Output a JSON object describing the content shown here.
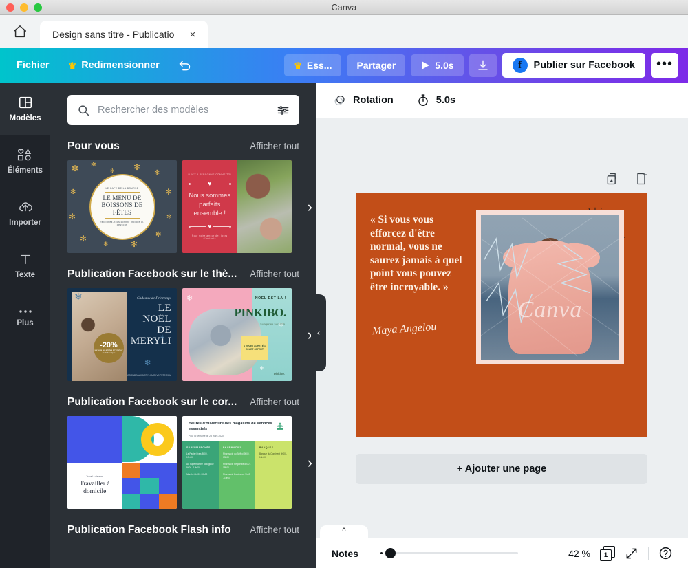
{
  "window": {
    "app_title": "Canva"
  },
  "browser": {
    "home_icon": "home-icon",
    "tab_title": "Design sans titre - Publicatio",
    "close_icon": "×"
  },
  "toolbar": {
    "file_label": "Fichier",
    "resize_label": "Redimensionner",
    "resize_crown": "♛",
    "undo_icon": "undo-icon",
    "try_label": "Ess...",
    "try_crown": "♛",
    "share_label": "Partager",
    "play_label": "5.0s",
    "download_icon": "download-icon",
    "publish_label": "Publier sur Facebook",
    "facebook_logo": "f",
    "more_label": "•••"
  },
  "rail": {
    "items": [
      {
        "label": "Modèles",
        "icon": "templates-icon",
        "active": true
      },
      {
        "label": "Éléments",
        "icon": "elements-icon",
        "active": false
      },
      {
        "label": "Importer",
        "icon": "upload-icon",
        "active": false
      },
      {
        "label": "Texte",
        "icon": "text-icon",
        "active": false
      },
      {
        "label": "Plus",
        "icon": "more-dots-icon",
        "active": false
      }
    ]
  },
  "panel": {
    "search": {
      "placeholder": "Rechercher des modèles",
      "value": "",
      "search_icon": "search-icon",
      "filter_icon": "filter-icon"
    },
    "sections": [
      {
        "title": "Pour vous",
        "more_label": "Afficher tout",
        "arrow": "›",
        "templates": [
          {
            "name": "xmas-drinks-menu",
            "brand": "LE CAFE DE LA BOURSE",
            "heading": "LE MENU DE BOISSONS DE FÊTES",
            "caption": "Rejoignez-nous comme indiqué ci-dessous"
          },
          {
            "name": "couple-valentine",
            "mini_top": "IL N'Y A PERSONNE COMME TOI",
            "message": "Nous sommes parfaits ensemble !",
            "mini_bottom": "Pour notre amour des jours d'instants"
          }
        ]
      },
      {
        "title": "Publication Facebook sur le thè...",
        "more_label": "Afficher tout",
        "arrow": "›",
        "templates": [
          {
            "name": "noel-meryli",
            "script": "Cadeaux de Printemps",
            "heading": "LE NOËL DE MERYLI",
            "badge_value": "-20%",
            "badge_note": "sur tous les articles à l'intérieur de la boutique",
            "footer": "LES CADEAUX MERYLI.ARRIVE-FETE.COM"
          },
          {
            "name": "pinkibo-toys",
            "eyebrow": "NOËL EST LÀ !",
            "brand": "PINKIBO.",
            "sub": "JUSQU'AU 24/12/20",
            "promo": "1 JOUET ACHETÉ 1 JOUET OFFERT",
            "logo": "pinkibo."
          }
        ]
      },
      {
        "title": "Publication Facebook sur le cor...",
        "more_label": "Afficher tout",
        "arrow": "›",
        "templates": [
          {
            "name": "geometric-remote-work",
            "eyebrow": "Travail à distance",
            "heading": "Travailler à domicile"
          },
          {
            "name": "store-hours",
            "heading": "Heures d'ouverture des magasins de services essentiels",
            "sub": "Pour la semaine du 23 mars 2020",
            "columns": [
              {
                "title": "SUPERMARCHÉS",
                "items": [
                  "Le Panier Frais 8h00 - 19h00",
                  "Au Supermarché Biologique 9h00 - 18h00",
                  "Marché 8h00 - 20h00"
                ]
              },
              {
                "title": "PHARMACIES",
                "items": [
                  "Pharmacie du Beffroi 9h00 - 19h00",
                  "Pharmacie Régionale 8h30 - 18h00",
                  "Pharmacie Espérance 9h00 - 19h00"
                ]
              },
              {
                "title": "BANQUES",
                "items": [
                  "Banque du Continent 9h00 - 16h00"
                ]
              }
            ]
          }
        ]
      },
      {
        "title": "Publication Facebook Flash info",
        "more_label": "Afficher tout",
        "arrow": "›",
        "templates": []
      }
    ],
    "collapse_icon": "‹"
  },
  "context_bar": {
    "rotation_label": "Rotation",
    "rotation_icon": "rotation-icon",
    "timer_label": "5.0s",
    "timer_icon": "timer-icon"
  },
  "page_tools": {
    "duplicate_icon": "duplicate-page-icon",
    "add_icon": "add-page-icon"
  },
  "design": {
    "background_color": "#c24e18",
    "quote": "« Si vous vous efforcez d'être normal, vous ne saurez jamais à quel point vous pouvez être incroyable. »",
    "author": "Maya Angelou",
    "watermark": "Canva"
  },
  "add_page": {
    "label": "+ Ajouter une page"
  },
  "bottom_bar": {
    "notes_label": "Notes",
    "zoom_value": "42 %",
    "page_number": "1",
    "pages_icon": "pages-icon",
    "fullscreen_icon": "fullscreen-icon",
    "help_icon": "help-icon",
    "collapse_icon": "^"
  }
}
